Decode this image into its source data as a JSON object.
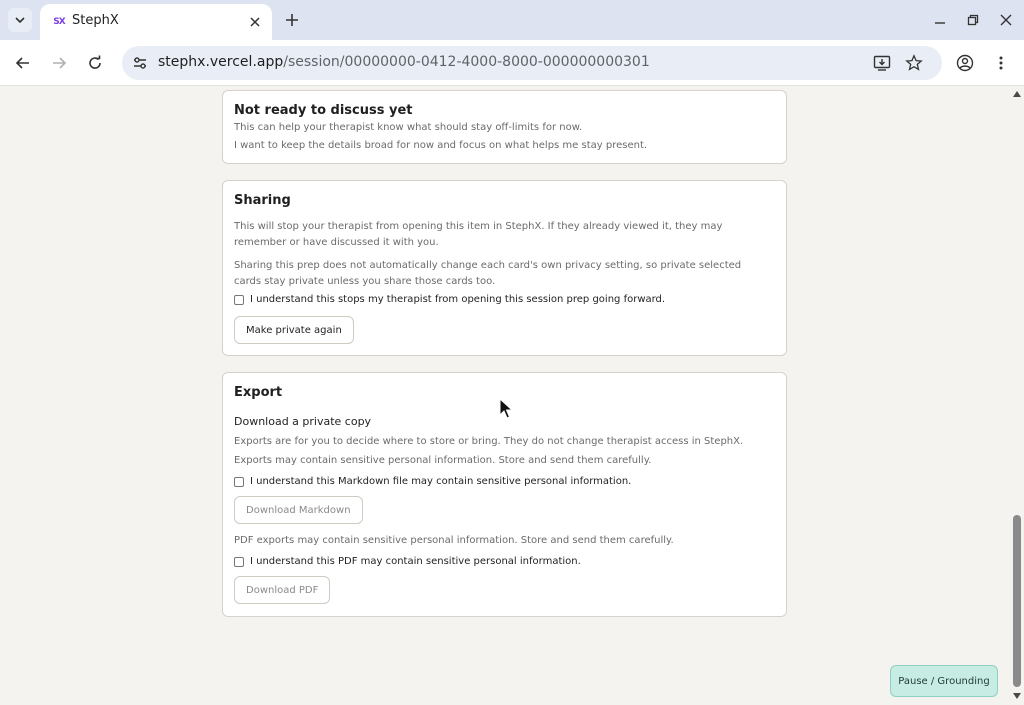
{
  "browser": {
    "tab_title": "StephX",
    "favicon_text": "SX",
    "url_host": "stephx.vercel.app",
    "url_path": "/session/00000000-0412-4000-8000-000000000301"
  },
  "cards": {
    "not_ready": {
      "title": "Not ready to discuss yet",
      "line1": "This can help your therapist know what should stay off-limits for now.",
      "line2": "I want to keep the details broad for now and focus on what helps me stay present."
    },
    "sharing": {
      "title": "Sharing",
      "para1": "This will stop your therapist from opening this item in StephX. If they already viewed it, they may remember or have discussed it with you.",
      "para2": "Sharing this prep does not automatically change each card's own privacy setting, so private selected cards stay private unless you share those cards too.",
      "checkbox_label": "I understand this stops my therapist from opening this session prep going forward.",
      "button": "Make private again"
    },
    "export": {
      "title": "Export",
      "subtitle": "Download a private copy",
      "line1": "Exports are for you to decide where to store or bring. They do not change therapist access in StephX.",
      "line2": "Exports may contain sensitive personal information. Store and send them carefully.",
      "md_checkbox": "I understand this Markdown file may contain sensitive personal information.",
      "md_button": "Download Markdown",
      "pdf_note": "PDF exports may contain sensitive personal information. Store and send them carefully.",
      "pdf_checkbox": "I understand this PDF may contain sensitive personal information.",
      "pdf_button": "Download PDF"
    }
  },
  "floating": {
    "pause_button": "Pause / Grounding"
  },
  "colors": {
    "page_bg": "#f4f3f0",
    "pause_bg": "#c7ece3",
    "tabbar_bg": "#dde3f0"
  }
}
